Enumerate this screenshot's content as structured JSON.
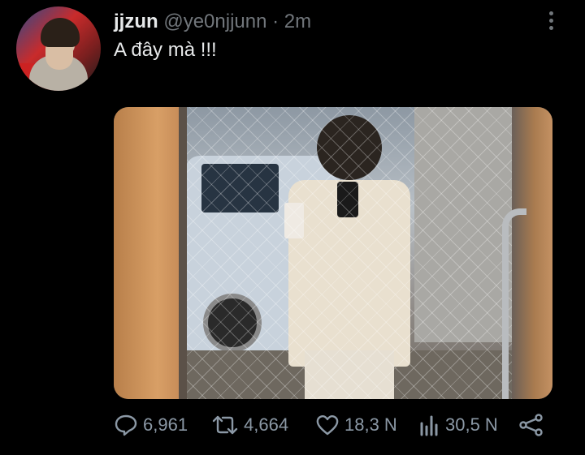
{
  "tweet": {
    "display_name": "jjzun",
    "handle": "@ye0njjunn",
    "separator": "·",
    "time": "2m",
    "text": "A đây mà !!!"
  },
  "stats": {
    "replies": "6,961",
    "retweets": "4,664",
    "likes": "18,3 N",
    "views": "30,5 N"
  },
  "icons": {
    "more": "more-vertical-icon",
    "reply": "reply-icon",
    "retweet": "retweet-icon",
    "like": "heart-icon",
    "views": "views-icon",
    "share": "share-icon"
  },
  "colors": {
    "background": "#000000",
    "text": "#e7e9ea",
    "secondary": "#71767b",
    "action": "#8b98a5"
  }
}
